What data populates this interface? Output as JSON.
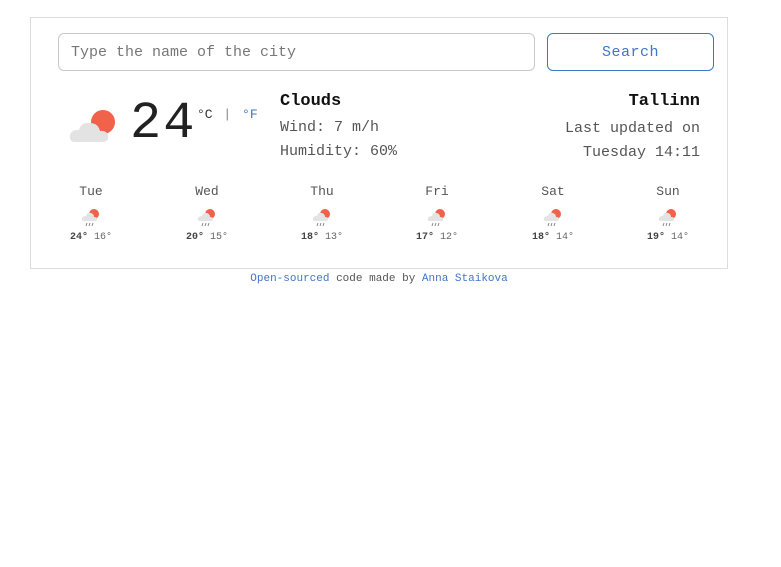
{
  "search": {
    "placeholder": "Type the name of the city",
    "button_label": "Search"
  },
  "current": {
    "icon": "partly-cloudy-icon",
    "temperature": "24",
    "unit_celsius": "°C",
    "unit_separator": "|",
    "unit_fahrenheit": "°F",
    "description": "Clouds",
    "wind": "Wind: 7 m/h",
    "humidity": "Humidity: 60%",
    "city": "Tallinn",
    "updated_label": "Last updated on",
    "updated_time": "Tuesday 14:11"
  },
  "forecast": [
    {
      "day": "Tue",
      "high": "24°",
      "low": "16°",
      "icon": "rain-sun-icon"
    },
    {
      "day": "Wed",
      "high": "20°",
      "low": "15°",
      "icon": "rain-sun-icon"
    },
    {
      "day": "Thu",
      "high": "18°",
      "low": "13°",
      "icon": "rain-sun-icon"
    },
    {
      "day": "Fri",
      "high": "17°",
      "low": "12°",
      "icon": "rain-sun-icon"
    },
    {
      "day": "Sat",
      "high": "18°",
      "low": "14°",
      "icon": "rain-sun-icon"
    },
    {
      "day": "Sun",
      "high": "19°",
      "low": "14°",
      "icon": "rain-sun-icon"
    }
  ],
  "footer": {
    "link1": "Open-sourced",
    "middle": " code made by ",
    "link2": "Anna Staikova"
  },
  "colors": {
    "accent": "#3f76c5",
    "sun": "#f0634a",
    "cloud": "#e3e3e3"
  }
}
